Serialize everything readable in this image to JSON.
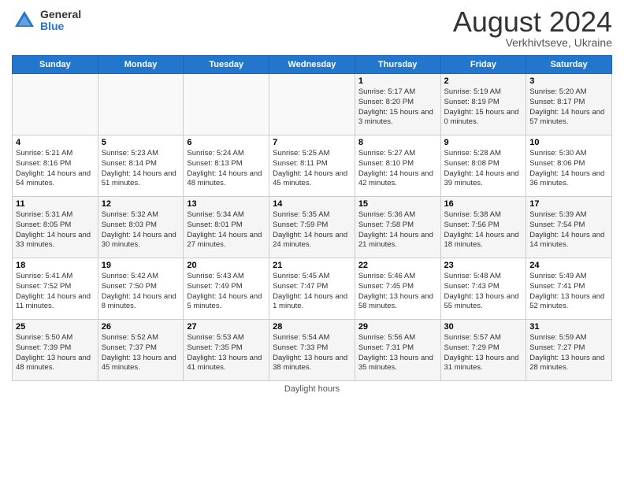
{
  "header": {
    "logo_general": "General",
    "logo_blue": "Blue",
    "month_title": "August 2024",
    "location": "Verkhivtseve, Ukraine"
  },
  "days_of_week": [
    "Sunday",
    "Monday",
    "Tuesday",
    "Wednesday",
    "Thursday",
    "Friday",
    "Saturday"
  ],
  "footer": {
    "daylight_label": "Daylight hours"
  },
  "weeks": [
    [
      {
        "day": "",
        "sunrise": "",
        "sunset": "",
        "daylight": ""
      },
      {
        "day": "",
        "sunrise": "",
        "sunset": "",
        "daylight": ""
      },
      {
        "day": "",
        "sunrise": "",
        "sunset": "",
        "daylight": ""
      },
      {
        "day": "",
        "sunrise": "",
        "sunset": "",
        "daylight": ""
      },
      {
        "day": "1",
        "sunrise": "Sunrise: 5:17 AM",
        "sunset": "Sunset: 8:20 PM",
        "daylight": "Daylight: 15 hours and 3 minutes."
      },
      {
        "day": "2",
        "sunrise": "Sunrise: 5:19 AM",
        "sunset": "Sunset: 8:19 PM",
        "daylight": "Daylight: 15 hours and 0 minutes."
      },
      {
        "day": "3",
        "sunrise": "Sunrise: 5:20 AM",
        "sunset": "Sunset: 8:17 PM",
        "daylight": "Daylight: 14 hours and 57 minutes."
      }
    ],
    [
      {
        "day": "4",
        "sunrise": "Sunrise: 5:21 AM",
        "sunset": "Sunset: 8:16 PM",
        "daylight": "Daylight: 14 hours and 54 minutes."
      },
      {
        "day": "5",
        "sunrise": "Sunrise: 5:23 AM",
        "sunset": "Sunset: 8:14 PM",
        "daylight": "Daylight: 14 hours and 51 minutes."
      },
      {
        "day": "6",
        "sunrise": "Sunrise: 5:24 AM",
        "sunset": "Sunset: 8:13 PM",
        "daylight": "Daylight: 14 hours and 48 minutes."
      },
      {
        "day": "7",
        "sunrise": "Sunrise: 5:25 AM",
        "sunset": "Sunset: 8:11 PM",
        "daylight": "Daylight: 14 hours and 45 minutes."
      },
      {
        "day": "8",
        "sunrise": "Sunrise: 5:27 AM",
        "sunset": "Sunset: 8:10 PM",
        "daylight": "Daylight: 14 hours and 42 minutes."
      },
      {
        "day": "9",
        "sunrise": "Sunrise: 5:28 AM",
        "sunset": "Sunset: 8:08 PM",
        "daylight": "Daylight: 14 hours and 39 minutes."
      },
      {
        "day": "10",
        "sunrise": "Sunrise: 5:30 AM",
        "sunset": "Sunset: 8:06 PM",
        "daylight": "Daylight: 14 hours and 36 minutes."
      }
    ],
    [
      {
        "day": "11",
        "sunrise": "Sunrise: 5:31 AM",
        "sunset": "Sunset: 8:05 PM",
        "daylight": "Daylight: 14 hours and 33 minutes."
      },
      {
        "day": "12",
        "sunrise": "Sunrise: 5:32 AM",
        "sunset": "Sunset: 8:03 PM",
        "daylight": "Daylight: 14 hours and 30 minutes."
      },
      {
        "day": "13",
        "sunrise": "Sunrise: 5:34 AM",
        "sunset": "Sunset: 8:01 PM",
        "daylight": "Daylight: 14 hours and 27 minutes."
      },
      {
        "day": "14",
        "sunrise": "Sunrise: 5:35 AM",
        "sunset": "Sunset: 7:59 PM",
        "daylight": "Daylight: 14 hours and 24 minutes."
      },
      {
        "day": "15",
        "sunrise": "Sunrise: 5:36 AM",
        "sunset": "Sunset: 7:58 PM",
        "daylight": "Daylight: 14 hours and 21 minutes."
      },
      {
        "day": "16",
        "sunrise": "Sunrise: 5:38 AM",
        "sunset": "Sunset: 7:56 PM",
        "daylight": "Daylight: 14 hours and 18 minutes."
      },
      {
        "day": "17",
        "sunrise": "Sunrise: 5:39 AM",
        "sunset": "Sunset: 7:54 PM",
        "daylight": "Daylight: 14 hours and 14 minutes."
      }
    ],
    [
      {
        "day": "18",
        "sunrise": "Sunrise: 5:41 AM",
        "sunset": "Sunset: 7:52 PM",
        "daylight": "Daylight: 14 hours and 11 minutes."
      },
      {
        "day": "19",
        "sunrise": "Sunrise: 5:42 AM",
        "sunset": "Sunset: 7:50 PM",
        "daylight": "Daylight: 14 hours and 8 minutes."
      },
      {
        "day": "20",
        "sunrise": "Sunrise: 5:43 AM",
        "sunset": "Sunset: 7:49 PM",
        "daylight": "Daylight: 14 hours and 5 minutes."
      },
      {
        "day": "21",
        "sunrise": "Sunrise: 5:45 AM",
        "sunset": "Sunset: 7:47 PM",
        "daylight": "Daylight: 14 hours and 1 minute."
      },
      {
        "day": "22",
        "sunrise": "Sunrise: 5:46 AM",
        "sunset": "Sunset: 7:45 PM",
        "daylight": "Daylight: 13 hours and 58 minutes."
      },
      {
        "day": "23",
        "sunrise": "Sunrise: 5:48 AM",
        "sunset": "Sunset: 7:43 PM",
        "daylight": "Daylight: 13 hours and 55 minutes."
      },
      {
        "day": "24",
        "sunrise": "Sunrise: 5:49 AM",
        "sunset": "Sunset: 7:41 PM",
        "daylight": "Daylight: 13 hours and 52 minutes."
      }
    ],
    [
      {
        "day": "25",
        "sunrise": "Sunrise: 5:50 AM",
        "sunset": "Sunset: 7:39 PM",
        "daylight": "Daylight: 13 hours and 48 minutes."
      },
      {
        "day": "26",
        "sunrise": "Sunrise: 5:52 AM",
        "sunset": "Sunset: 7:37 PM",
        "daylight": "Daylight: 13 hours and 45 minutes."
      },
      {
        "day": "27",
        "sunrise": "Sunrise: 5:53 AM",
        "sunset": "Sunset: 7:35 PM",
        "daylight": "Daylight: 13 hours and 41 minutes."
      },
      {
        "day": "28",
        "sunrise": "Sunrise: 5:54 AM",
        "sunset": "Sunset: 7:33 PM",
        "daylight": "Daylight: 13 hours and 38 minutes."
      },
      {
        "day": "29",
        "sunrise": "Sunrise: 5:56 AM",
        "sunset": "Sunset: 7:31 PM",
        "daylight": "Daylight: 13 hours and 35 minutes."
      },
      {
        "day": "30",
        "sunrise": "Sunrise: 5:57 AM",
        "sunset": "Sunset: 7:29 PM",
        "daylight": "Daylight: 13 hours and 31 minutes."
      },
      {
        "day": "31",
        "sunrise": "Sunrise: 5:59 AM",
        "sunset": "Sunset: 7:27 PM",
        "daylight": "Daylight: 13 hours and 28 minutes."
      }
    ]
  ]
}
